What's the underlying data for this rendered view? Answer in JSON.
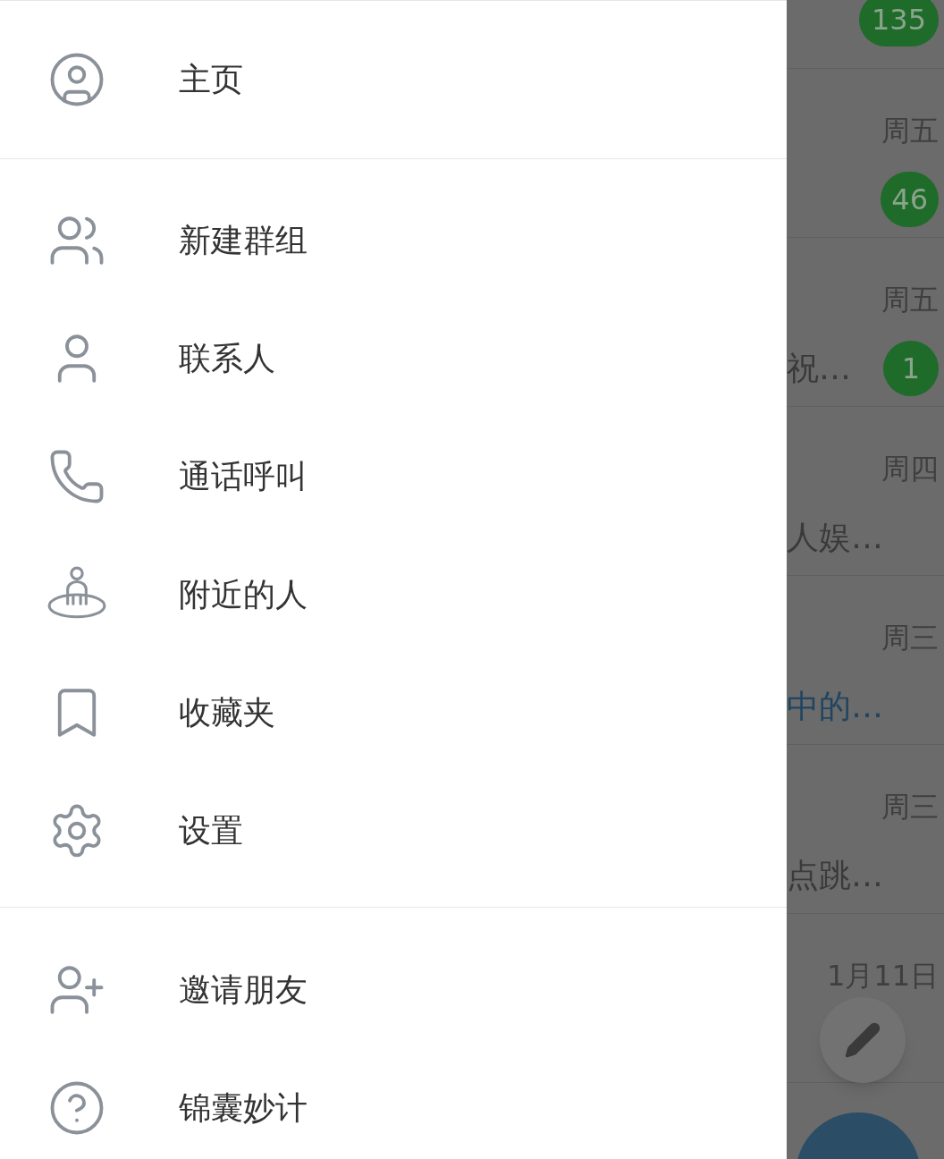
{
  "drawer": {
    "sections": [
      {
        "items": [
          {
            "label": "主页"
          }
        ]
      },
      {
        "items": [
          {
            "label": "新建群组"
          },
          {
            "label": "联系人"
          },
          {
            "label": "通话呼叫"
          },
          {
            "label": "附近的人"
          },
          {
            "label": "收藏夹"
          },
          {
            "label": "设置"
          }
        ]
      },
      {
        "items": [
          {
            "label": "邀请朋友"
          },
          {
            "label": "锦囊妙计"
          }
        ]
      }
    ]
  },
  "chat_list": [
    {
      "badge": "135"
    },
    {
      "time": "周五",
      "badge": "46"
    },
    {
      "time": "周五",
      "preview": "祝…",
      "preview_highlighted": false,
      "badge": "1"
    },
    {
      "time": "周四",
      "preview": "人娱…",
      "preview_highlighted": false
    },
    {
      "time": "周三",
      "preview": "中的…",
      "preview_highlighted": true
    },
    {
      "time": "周三",
      "preview": "点跳…",
      "preview_highlighted": false
    },
    {
      "time": "1月11日"
    }
  ]
}
